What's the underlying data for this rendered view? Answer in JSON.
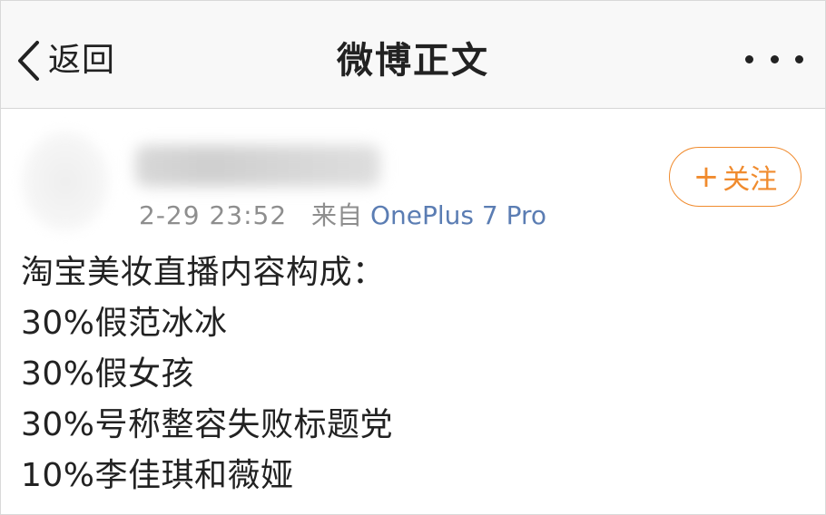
{
  "navbar": {
    "back_label": "返回",
    "title": "微博正文",
    "back_icon": "chevron-left-icon",
    "more_icon": "more-dots-icon"
  },
  "post": {
    "timestamp": "2-29 23:52",
    "source_prefix": "来自",
    "device": "OnePlus 7 Pro",
    "follow_label": "关注",
    "follow_icon": "plus-icon",
    "lines": [
      "淘宝美妆直播内容构成：",
      "30%假范冰冰",
      "30%假女孩",
      "30%号称整容失败标题党",
      "10%李佳琪和薇娅"
    ]
  },
  "colors": {
    "accent_orange": "#f08b2e",
    "link_blue": "#5b7db3",
    "meta_gray": "#8e8e8e",
    "navbar_bg": "#f8f8f8"
  }
}
